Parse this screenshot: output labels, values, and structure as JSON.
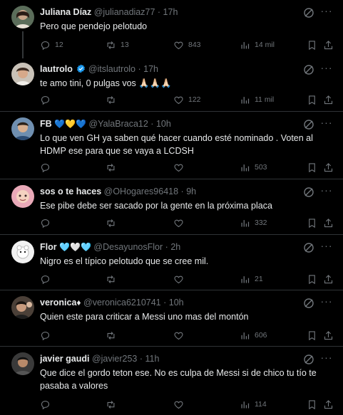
{
  "tweets": [
    {
      "name": "Juliana Díaz",
      "handle": "@julianadiaz77",
      "time": "17h",
      "text": "Pero que pendejo pelotudo",
      "replies": "12",
      "retweets": "13",
      "likes": "843",
      "views": "14 mil"
    },
    {
      "name": "lautrolo",
      "verified": true,
      "handle": "@itslautrolo",
      "time": "17h",
      "text": "te amo tini, 0 pulgas vos 🙏🏻🙏🏻🙏🏻",
      "replies": "",
      "retweets": "",
      "likes": "122",
      "views": "11 mil"
    },
    {
      "name": "FB",
      "name_emojis": "💙💛💙",
      "handle": "@YalaBraca12",
      "time": "10h",
      "text": "Lo que ven GH ya saben qué hacer cuando esté nominado . Voten al HDMP ese para que se vaya a LCDSH",
      "replies": "",
      "retweets": "",
      "likes": "",
      "views": "503"
    },
    {
      "name": "sos o te haces",
      "handle": "@OHogares96418",
      "time": "9h",
      "text": "Ese pibe debe ser sacado por la gente en la próxima placa",
      "replies": "",
      "retweets": "",
      "likes": "",
      "views": "332"
    },
    {
      "name": "Flor",
      "name_emojis": "🩵🤍🩵",
      "handle": "@DesayunosFlor",
      "time": "2h",
      "text": "Nigro es el típico pelotudo que se cree mil.",
      "replies": "",
      "retweets": "",
      "likes": "",
      "views": "21"
    },
    {
      "name": "veronica",
      "name_emojis": "♦",
      "handle": "@veronica6210741",
      "time": "10h",
      "text": "Quien este para criticar a Messi  uno mas del montón",
      "replies": "",
      "retweets": "",
      "likes": "",
      "views": "606"
    },
    {
      "name": "javier gaudi",
      "handle": "@javier253",
      "time": "11h",
      "text": "Que dice el gordo teton ese. No es culpa de Messi si de chico tu tío te pasaba a valores",
      "replies": "",
      "retweets": "",
      "likes": "",
      "views": "114"
    }
  ],
  "icons": {
    "more": "more-icon",
    "grok": "grok-icon",
    "reply": "reply-icon",
    "retweet": "retweet-icon",
    "like": "like-icon",
    "views": "views-icon",
    "bookmark": "bookmark-icon",
    "share": "share-icon",
    "verified": "verified-badge-icon"
  },
  "colors": {
    "background": "#000000",
    "text": "#e7e9ea",
    "secondary": "#71767b",
    "divider": "#2f3336",
    "verified": "#1d9bf0"
  }
}
